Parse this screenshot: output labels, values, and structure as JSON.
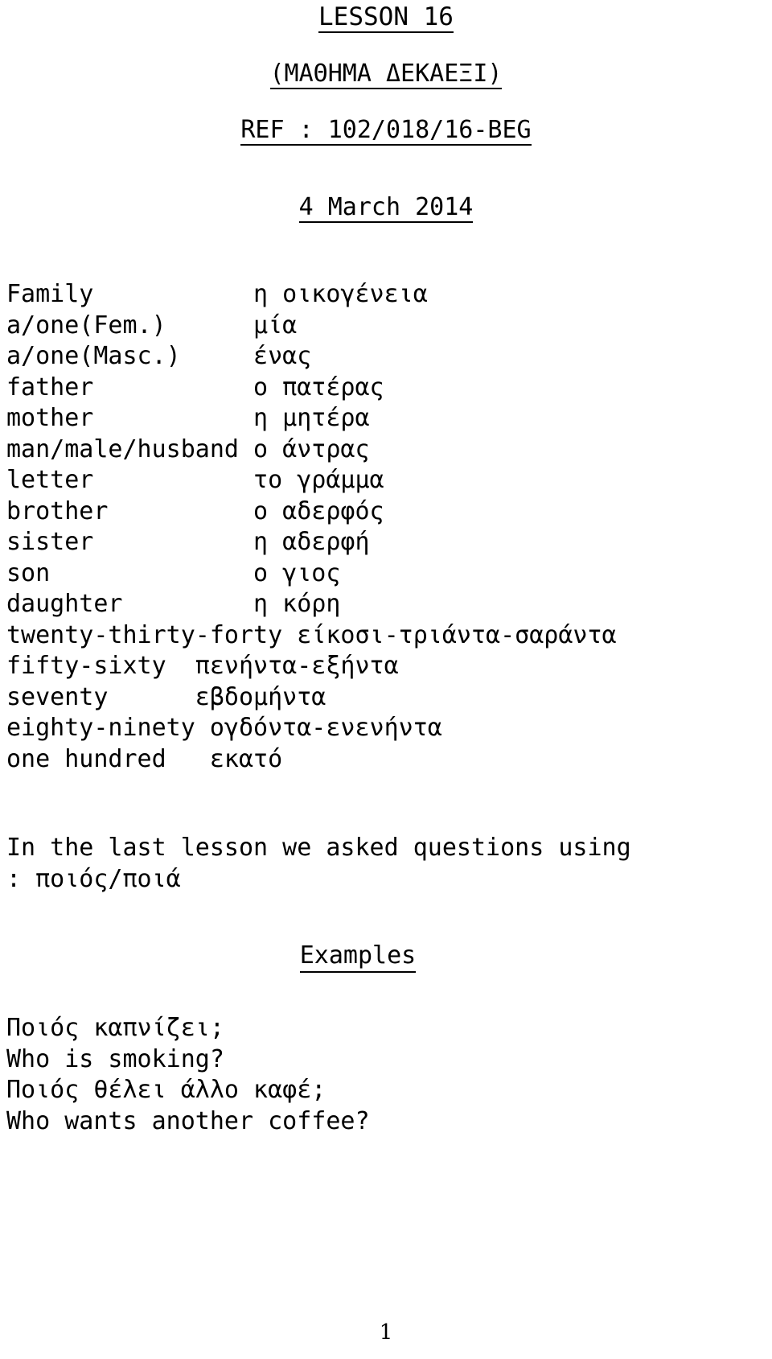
{
  "document": {
    "title_lesson": "LESSON 16",
    "title_greek": "(ΜΑΘΗΜΑ ΔΕΚΑΕΞΙ)",
    "reference": "REF : 102/018/16-BEG",
    "date": "4 March 2014",
    "page_number": "1"
  },
  "vocabulary": {
    "lines": [
      "Family           η οικογένεια",
      "a/one(Fem.)      μία",
      "a/one(Masc.)     ένας",
      "father           ο πατέρας",
      "mother           η μητέρα",
      "man/male/husband ο άντρας",
      "letter           το γράμμα",
      "brother          ο αδερφός",
      "sister           η αδερφή",
      "son              ο γιος",
      "daughter         η κόρη",
      "twenty-thirty-forty είκοσι-τριάντα-σαράντα",
      "fifty-sixty  πενήντα-εξήντα",
      "seventy      εβδομήντα",
      "eighty-ninety ογδόντα-ενενήντα",
      "one hundred   εκατό"
    ],
    "entries": [
      {
        "english": "Family",
        "greek": "η οικογένεια"
      },
      {
        "english": "a/one(Fem.)",
        "greek": "μία"
      },
      {
        "english": "a/one(Masc.)",
        "greek": "ένας"
      },
      {
        "english": "father",
        "greek": "ο πατέρας"
      },
      {
        "english": "mother",
        "greek": "η μητέρα"
      },
      {
        "english": "man/male/husband",
        "greek": "ο άντρας"
      },
      {
        "english": "letter",
        "greek": "το γράμμα"
      },
      {
        "english": "brother",
        "greek": "ο αδερφός"
      },
      {
        "english": "sister",
        "greek": "η αδερφή"
      },
      {
        "english": "son",
        "greek": "ο γιος"
      },
      {
        "english": "daughter",
        "greek": "η κόρη"
      },
      {
        "english": "twenty-thirty-forty",
        "greek": "είκοσι-τριάντα-σαράντα"
      },
      {
        "english": "fifty-sixty",
        "greek": "πενήντα-εξήντα"
      },
      {
        "english": "seventy",
        "greek": "εβδομήντα"
      },
      {
        "english": "eighty-ninety",
        "greek": "ογδόντα-ενενήντα"
      },
      {
        "english": "one hundred",
        "greek": "εκατό"
      }
    ]
  },
  "intro_paragraph": "In the last lesson we asked questions using\n: ποιός/ποιά",
  "examples": {
    "heading": "Examples",
    "lines": [
      "Ποιός καπνίζει;",
      "Who is smoking?",
      "Ποιός θέλει άλλο καφέ;",
      "Who wants another coffee?"
    ],
    "pairs": [
      {
        "greek": "Ποιός καπνίζει;",
        "english": "Who is smoking?"
      },
      {
        "greek": "Ποιός θέλει άλλο καφέ;",
        "english": "Who wants another coffee?"
      }
    ]
  }
}
